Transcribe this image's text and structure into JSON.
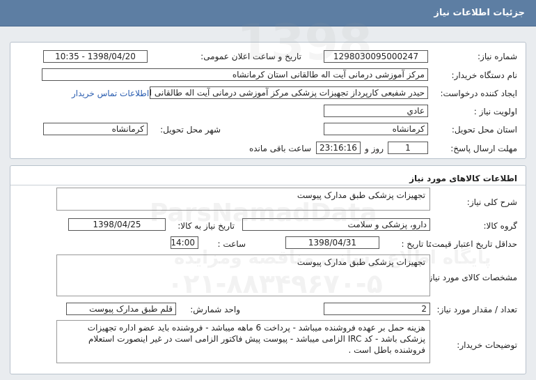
{
  "header": {
    "title": "جزئیات اطلاعات نیاز"
  },
  "details": {
    "need_number_label": "شماره نیاز:",
    "need_number": "1298030095000247",
    "announce_label": "تاریخ و ساعت اعلان عمومی:",
    "announce_value": "1398/04/20 - 10:35",
    "buyer_label": "نام دستگاه خریدار:",
    "buyer_value": "مرکز آموزشی درمانی آیت اله طالقانی استان کرمانشاه",
    "creator_label": "ایجاد کننده درخواست:",
    "creator_value": "حیدر شفیعی کارپرداز تجهیزات پزشکی مرکز آموزشی درمانی آیت اله طالقانی اس",
    "contact_link": "اطلاعات تماس خریدار",
    "priority_label": "اولویت نیاز :",
    "priority_value": "عادي",
    "province_label": "استان محل تحویل:",
    "province_value": "کرمانشاه",
    "city_label": "شهر محل تحویل:",
    "city_value": "کرمانشاه",
    "deadline_label": "مهلت ارسال پاسخ:",
    "deadline_days": "1",
    "day_and": "روز و",
    "deadline_time": "23:16:16",
    "remaining_text": "ساعت باقی مانده"
  },
  "goods": {
    "section_title": "اطلاعات کالاهای مورد نیاز",
    "summary_label": "شرح کلی نیاز:",
    "summary_value": "تجهیزات پزشکی طبق مدارک پیوست",
    "group_label": "گروه کالا:",
    "group_value": "دارو، پزشکی و سلامت",
    "need_date_label": "تاریخ نیاز به کالا:",
    "need_date_value": "1398/04/25",
    "price_valid_label": "حداقل تاریخ اعتبار قیمت:",
    "until_date_label": "تا تاریخ :",
    "until_date_value": "1398/04/31",
    "hour_label": "ساعت :",
    "hour_value": "14:00",
    "spec_label": "مشخصات کالای مورد نیاز:",
    "spec_value": "تجهیزات پزشکی طبق مدارک پیوست",
    "qty_label": "تعداد / مقدار مورد نیاز:",
    "qty_value": "2",
    "unit_label": "واحد شمارش:",
    "unit_value": "قلم طبق مدارک پیوست",
    "notes_label": "توضیحات خریدار:",
    "notes_value": "هزینه حمل بر عهده فروشنده میباشد - پرداخت 6 ماهه میباشد - فروشنده باید عضو اداره تجهیزات پزشکی باشد - کد IRC  الزامی میباشد - پیوست پیش فاکتور الزامی است در غیر اینصورت استعلام فروشنده باطل است ."
  },
  "watermark": {
    "brand": "ParsNamadData",
    "line1": "پایگاه اطلاع رسانی مناقصه ومزایده",
    "line2": "۰۲۱-۸۸۳۴۹۶۷۰-۵",
    "year": "1398"
  }
}
